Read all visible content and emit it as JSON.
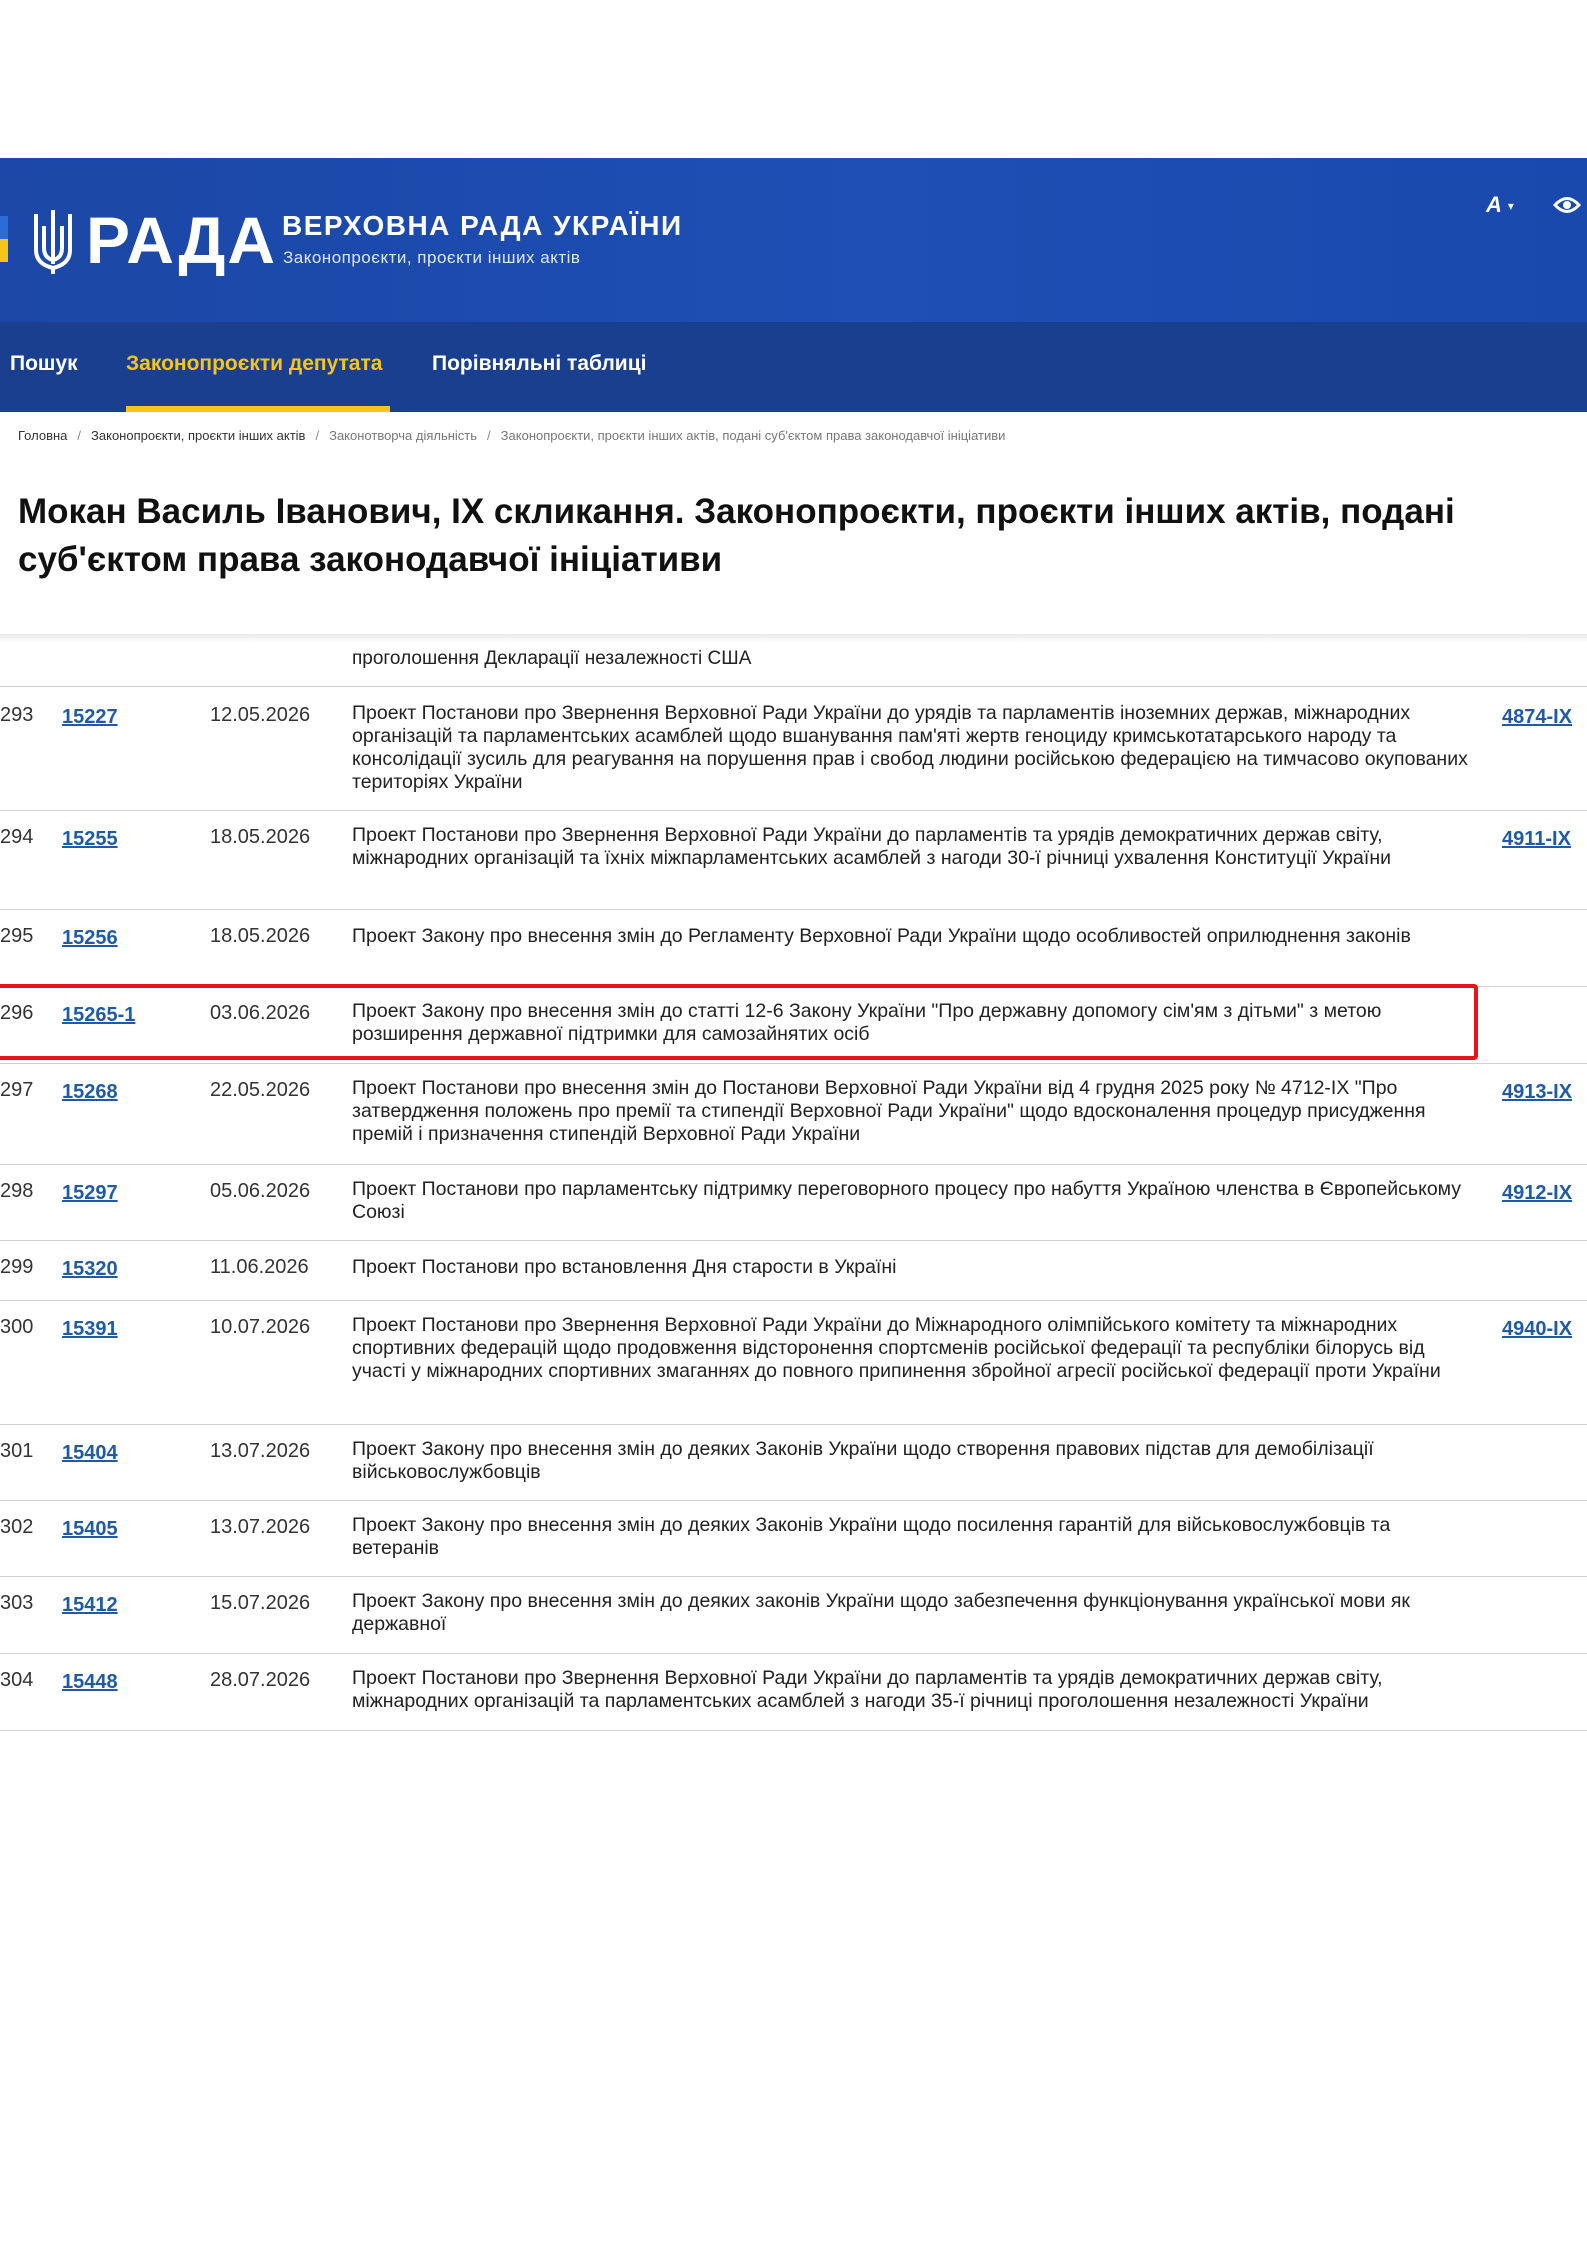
{
  "header": {
    "logo_text": "РАДА",
    "site_title": "ВЕРХОВНА РАДА УКРАЇНИ",
    "site_subtitle": "Законопроєкти, проєкти інших актів",
    "font_button": "A"
  },
  "nav": {
    "items": [
      {
        "label": "Пошук"
      },
      {
        "label": "Законопроєкти депутата"
      },
      {
        "label": "Порівняльні таблиці"
      }
    ]
  },
  "breadcrumb": {
    "items": [
      "Головна",
      "Законопроєкти, проєкти інших актів",
      "Законотворча діяльність",
      "Законопроєкти, проєкти інших актів, подані суб'єктом права законодавчої ініціативи"
    ]
  },
  "page_title": "Мокан Василь Іванович, IX скликання. Законопроєкти, проєкти інших актів, подані суб'єктом права законодавчої ініціативи",
  "table": {
    "cut_text": "проголошення Декларації незалежності США",
    "rows": [
      {
        "num": "293",
        "reg": "15227",
        "date": "12.05.2026",
        "title": "Проект Постанови про Звернення Верховної Ради України до урядів та парламентів іноземних держав, міжнародних організацій та парламентських асамблей щодо вшанування пам'яті жертв геноциду кримськотатарського народу та консолідації зусиль для реагування на порушення прав і свобод людини російською федерацією на тимчасово окупованих територіях України",
        "act": "4874-IX"
      },
      {
        "num": "294",
        "reg": "15255",
        "date": "18.05.2026",
        "title": "Проект Постанови про Звернення Верховної Ради України до парламентів та урядів демократичних держав світу, міжнародних організацій та їхніх міжпарламентських асамблей з нагоди 30-ї річниці ухвалення Конституції України",
        "act": "4911-IX"
      },
      {
        "num": "295",
        "reg": "15256",
        "date": "18.05.2026",
        "title": "Проект Закону про внесення змін до Регламенту Верховної Ради України щодо особливостей оприлюднення законів",
        "act": ""
      },
      {
        "num": "296",
        "reg": "15265-1",
        "date": "03.06.2026",
        "title": "Проект Закону про внесення змін до статті 12-6 Закону України \"Про державну допомогу сім'ям з дітьми\" з метою розширення державної підтримки для самозайнятих осіб",
        "act": ""
      },
      {
        "num": "297",
        "reg": "15268",
        "date": "22.05.2026",
        "title": "Проект Постанови про внесення змін до Постанови Верховної Ради України від 4 грудня 2025 року № 4712-IX \"Про затвердження положень про премії та стипендії Верховної Ради України\" щодо вдосконалення процедур присудження премій і призначення стипендій Верховної Ради України",
        "act": "4913-IX"
      },
      {
        "num": "298",
        "reg": "15297",
        "date": "05.06.2026",
        "title": "Проект Постанови про парламентську підтримку переговорного процесу про набуття Україною членства в Європейському Союзі",
        "act": "4912-IX"
      },
      {
        "num": "299",
        "reg": "15320",
        "date": "11.06.2026",
        "title": "Проект Постанови про встановлення Дня старости в Україні",
        "act": ""
      },
      {
        "num": "300",
        "reg": "15391",
        "date": "10.07.2026",
        "title": "Проект Постанови про Звернення Верховної Ради України до Міжнародного олімпійського комітету та міжнародних спортивних федерацій щодо продовження відсторонення спортсменів російської федерації та республіки білорусь від участі у міжнародних спортивних змаганнях до повного припинення збройної агресії російської федерації проти України",
        "act": "4940-IX"
      },
      {
        "num": "301",
        "reg": "15404",
        "date": "13.07.2026",
        "title": "Проект Закону про внесення змін до деяких Законів України щодо створення правових підстав для демобілізації військовослужбовців",
        "act": ""
      },
      {
        "num": "302",
        "reg": "15405",
        "date": "13.07.2026",
        "title": "Проект Закону про внесення змін до деяких Законів України щодо посилення гарантій для військовослужбовців та ветеранів",
        "act": ""
      },
      {
        "num": "303",
        "reg": "15412",
        "date": "15.07.2026",
        "title": "Проект Закону про внесення змін до деяких законів України щодо забезпечення функціонування української мови як державної",
        "act": ""
      },
      {
        "num": "304",
        "reg": "15448",
        "date": "28.07.2026",
        "title": "Проект Постанови про Звернення Верховної Ради України до парламентів та урядів демократичних держав світу, міжнародних організацій та парламентських асамблей з нагоди 35-ї річниці проголошення незалежності України",
        "act": ""
      }
    ]
  }
}
